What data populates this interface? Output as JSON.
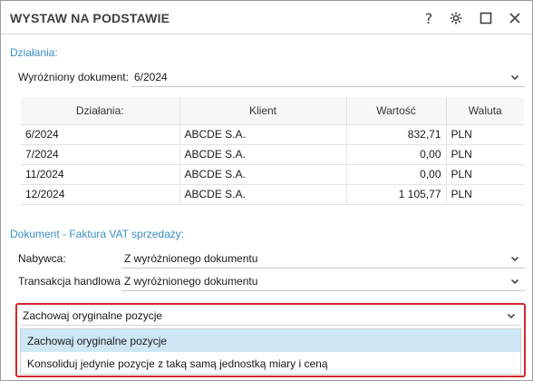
{
  "window": {
    "title": "WYSTAW NA PODSTAWIE"
  },
  "titlebar_icons": [
    "help-icon",
    "gear-icon",
    "maximize-icon",
    "close-icon"
  ],
  "colors": {
    "accent": "#3a8fc4",
    "highlight_border": "#d2282d",
    "selected_option_bg": "#cde8f4"
  },
  "actions_section": {
    "heading": "Działania:",
    "highlighted_doc_label": "Wyróżniony dokument:",
    "highlighted_doc_value": "6/2024"
  },
  "table": {
    "headers": [
      "Działania:",
      "Klient",
      "Wartość",
      "Waluta"
    ],
    "rows": [
      [
        "6/2024",
        "ABCDE S.A.",
        "832,71",
        "PLN"
      ],
      [
        "7/2024",
        "ABCDE S.A.",
        "0,00",
        "PLN"
      ],
      [
        "11/2024",
        "ABCDE S.A.",
        "0,00",
        "PLN"
      ],
      [
        "12/2024",
        "ABCDE S.A.",
        "1 105,77",
        "PLN"
      ]
    ]
  },
  "document_section": {
    "heading": "Dokument - Faktura VAT sprzedaży:",
    "buyer_label": "Nabywca:",
    "buyer_value": "Z wyróżnionego dokumentu",
    "transaction_label": "Transakcja handlowa:",
    "transaction_value": "Z wyróżnionego dokumentu"
  },
  "positions_combo": {
    "selected": "Zachowaj oryginalne pozycje",
    "options": [
      "Zachowaj oryginalne pozycje",
      "Konsoliduj jedynie pozycje z taką samą jednostką miary i ceną"
    ]
  }
}
